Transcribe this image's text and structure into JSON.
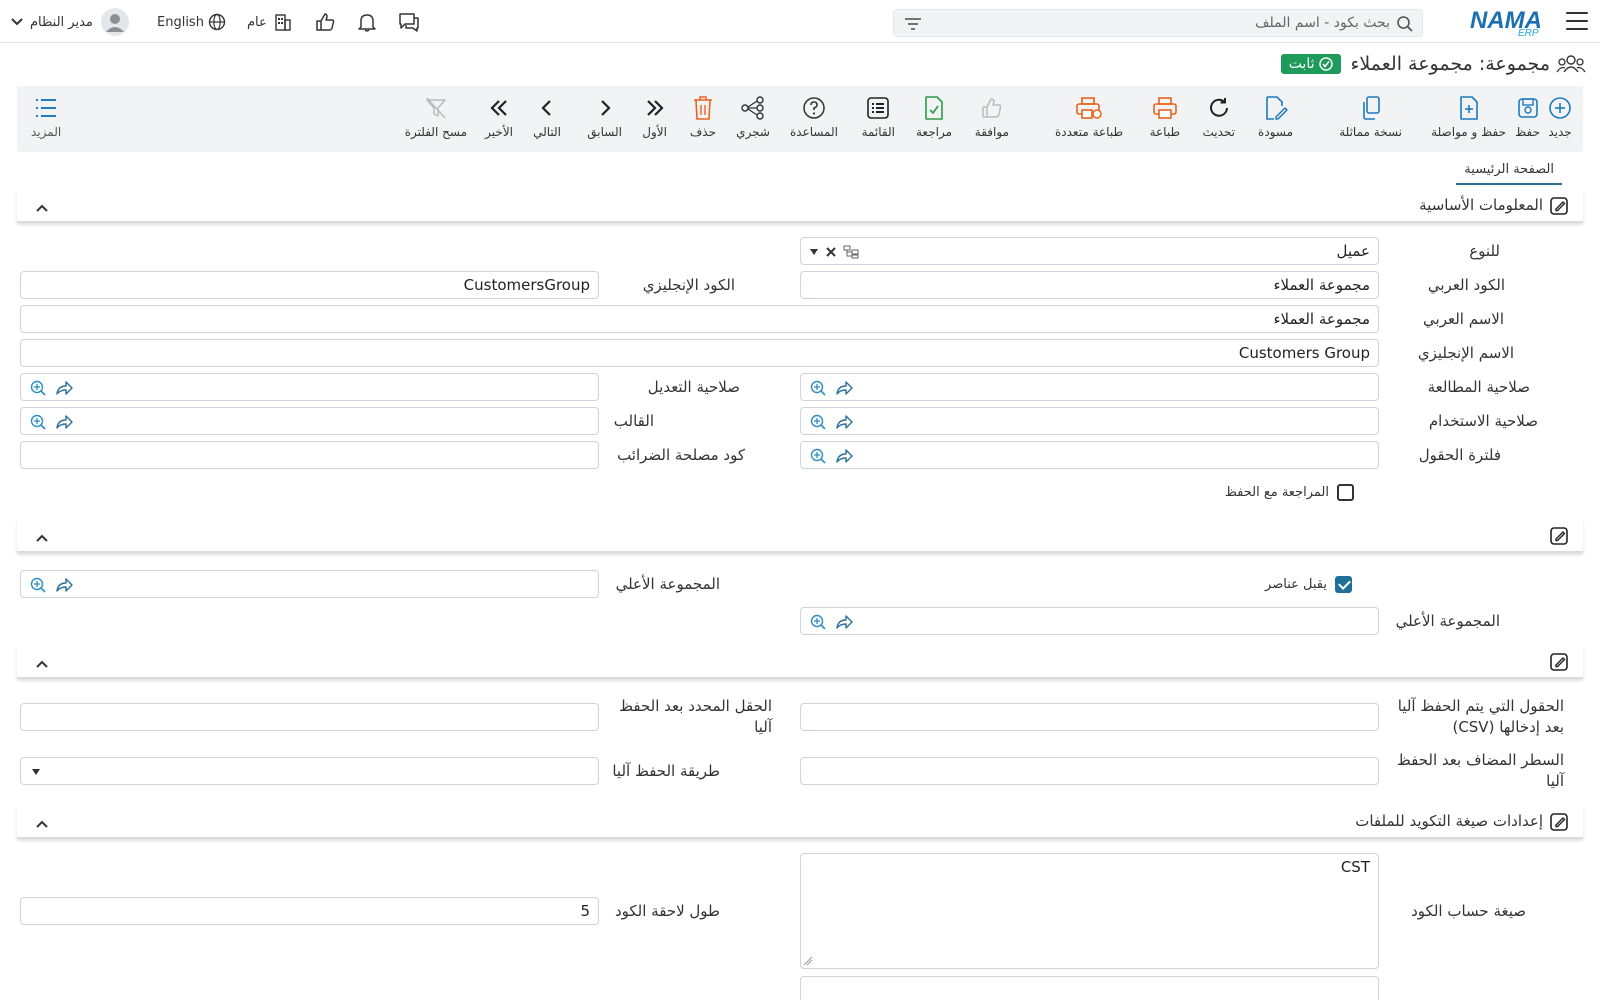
{
  "header": {
    "search_placeholder": "بحث بكود - اسم الملف",
    "user_name": "مدير النظام",
    "language": "English",
    "branch": "عام",
    "logo_text": "NAMA",
    "logo_sub": "ERP"
  },
  "page": {
    "title": "مجموعة: مجموعة العملاء",
    "status_badge": "ثابت"
  },
  "toolbar": {
    "new": "جديد",
    "save": "حفظ",
    "save_continue": "حفظ و مواصلة",
    "copy": "نسخة مماثلة",
    "draft": "مسودة",
    "refresh": "تحديث",
    "print": "طباعة",
    "multi_print": "طباعة متعددة",
    "approve": "موافقة",
    "review": "مراجعة",
    "list": "القائمة",
    "help": "المساعدة",
    "tree": "شجري",
    "delete": "حذف",
    "first": "الأول",
    "previous": "السابق",
    "next": "التالي",
    "last": "الأخير",
    "clear_filter": "مسح الفلترة",
    "more": "المزيد"
  },
  "tabs": {
    "main": "الصفحة الرئيسية"
  },
  "basic_section": {
    "title": "المعلومات الأساسية",
    "for_type_label": "للنوع",
    "for_type_value": "عميل",
    "arabic_code_label": "الكود العربي",
    "arabic_code_value": "مجموعة العملاء",
    "english_code_label": "الكود الإنجليزي",
    "english_code_value": "CustomersGroup",
    "arabic_name_label": "الاسم العربي",
    "arabic_name_value": "مجموعة العملاء",
    "english_name_label": "الاسم الإنجليزي",
    "english_name_value": "Customers Group",
    "view_perm_label": "صلاحية المطالعة",
    "edit_perm_label": "صلاحية التعديل",
    "use_perm_label": "صلاحية الاستخدام",
    "template_label": "القالب",
    "field_filter_label": "فلترة الحقول",
    "tax_code_label": "كود مصلحة الضرائب",
    "review_on_save_label": "المراجعة مع الحفظ"
  },
  "group_section": {
    "accepts_items_label": "يقبل عناصر",
    "parent_group_label": "المجموعة الأعلي",
    "parent_group_label_2": "المجموعة الأعلي"
  },
  "autosave_section": {
    "auto_fields_label": "الحقول التي يتم الحفظ آليا بعد إدخالها (CSV)",
    "selected_field_label": "الحقل المحدد بعد الحفظ آليا",
    "added_line_label": "السطر المضاف بعد الحفظ آليا",
    "save_method_label": "طريقة الحفظ آليا"
  },
  "coding_section": {
    "title": "إعدادات صيغة التكويد للملفات",
    "code_formula_label": "صيغة حساب الكود",
    "code_formula_value": "CST",
    "suffix_length_label": "طول لاحقة الكود",
    "suffix_length_value": "5"
  }
}
